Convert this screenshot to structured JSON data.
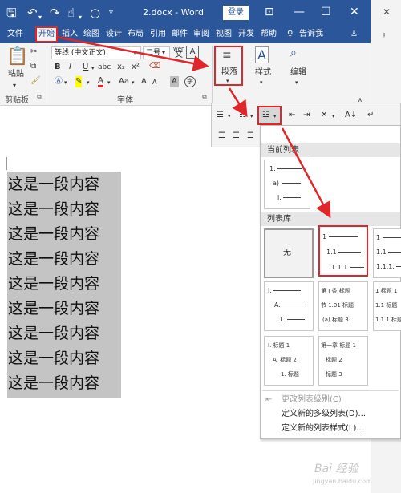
{
  "titlebar": {
    "doc_title": "2.docx - Word",
    "login_label": "登录"
  },
  "tabs": [
    {
      "label": "文件"
    },
    {
      "label": "开始"
    },
    {
      "label": "插入"
    },
    {
      "label": "绘图"
    },
    {
      "label": "设计"
    },
    {
      "label": "布局"
    },
    {
      "label": "引用"
    },
    {
      "label": "邮件"
    },
    {
      "label": "审阅"
    },
    {
      "label": "视图"
    },
    {
      "label": "开发"
    },
    {
      "label": "帮助"
    },
    {
      "label": "告诉我"
    }
  ],
  "ribbon": {
    "paste_label": "粘贴",
    "clipboard_label": "剪贴板",
    "font_name": "等线 (中文正文)",
    "font_size": "二号",
    "font_group_label": "字体",
    "paragraph_label": "段落",
    "style_label": "样式",
    "edit_label": "编辑",
    "wen_glyph": "wén",
    "wen_char": "文",
    "a_box": "A",
    "b": "B",
    "i": "I",
    "u": "U",
    "abc": "abc",
    "sub": "x₂",
    "sup": "x²",
    "aa": "Aa",
    "a_circle": "字"
  },
  "document": {
    "lines": [
      "这是一段内容",
      "这是一段内容",
      "这是一段内容",
      "这是一段内容",
      "这是一段内容",
      "这是一段内容",
      "这是一段内容",
      "这是一段内容",
      "这是一段内容"
    ]
  },
  "list_panel": {
    "current_header": "当前列表",
    "library_header": "列表库",
    "current_list": [
      "1.",
      "a)",
      "i."
    ],
    "none_label": "无",
    "multi1": [
      "1",
      "1.1",
      "1.1.1"
    ],
    "multi2": [
      "1",
      "1.1",
      "1.1.1."
    ],
    "roman": [
      "I.",
      "A.",
      "1."
    ],
    "article": [
      "第 I 条 标题",
      "节 1.01 标题",
      "(a) 标题 3"
    ],
    "numbered_heading": [
      "1 标题 1",
      "1.1 标题",
      "1.1.1 标题"
    ],
    "roman_heading": [
      "I. 标题 1",
      "A. 标题 2",
      "1. 标题"
    ],
    "chapter_heading": [
      "第一章 标题 1",
      "标题 2",
      "标题 3"
    ],
    "menu": {
      "change_level": "更改列表级别(C)",
      "define_multilevel": "定义新的多级列表(D)...",
      "define_style": "定义新的列表样式(L)..."
    }
  },
  "watermark": {
    "text": "Bai 经验",
    "url": "jingyan.baidu.com"
  },
  "colors": {
    "accent": "#2b579a",
    "highlight_red": "#e0262a"
  }
}
